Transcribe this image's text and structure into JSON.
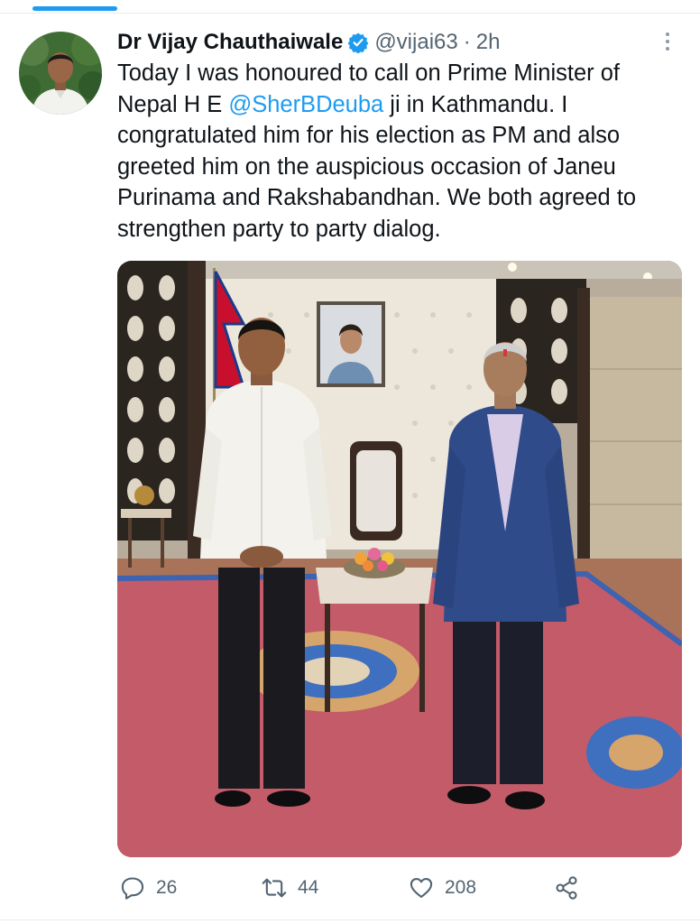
{
  "colors": {
    "accent": "#1d9bf0",
    "text_primary": "#0f1419",
    "text_secondary": "#536471"
  },
  "tweet": {
    "author": {
      "display_name": "Dr Vijay Chauthaiwale",
      "handle": "@vijai63",
      "verified": true
    },
    "separator": "·",
    "timestamp": "2h",
    "text_parts": {
      "before_mention": "Today I was honoured to call on Prime Minister of Nepal H E ",
      "mention": "@SherBDeuba",
      "after_mention": " ji in Kathmandu. I congratulated him for his election as PM and also greeted him on the auspicious occasion of Janeu Purinama and Rakshabandhan. We both agreed to strengthen party to party dialog."
    },
    "actions": {
      "replies": {
        "icon": "reply-icon",
        "count": "26"
      },
      "retweets": {
        "icon": "retweet-icon",
        "count": "44"
      },
      "likes": {
        "icon": "heart-icon",
        "count": "208"
      },
      "share": {
        "icon": "share-icon"
      }
    }
  },
  "icons": {
    "verified": "verified-badge-icon",
    "more": "more-vertical-icon"
  }
}
